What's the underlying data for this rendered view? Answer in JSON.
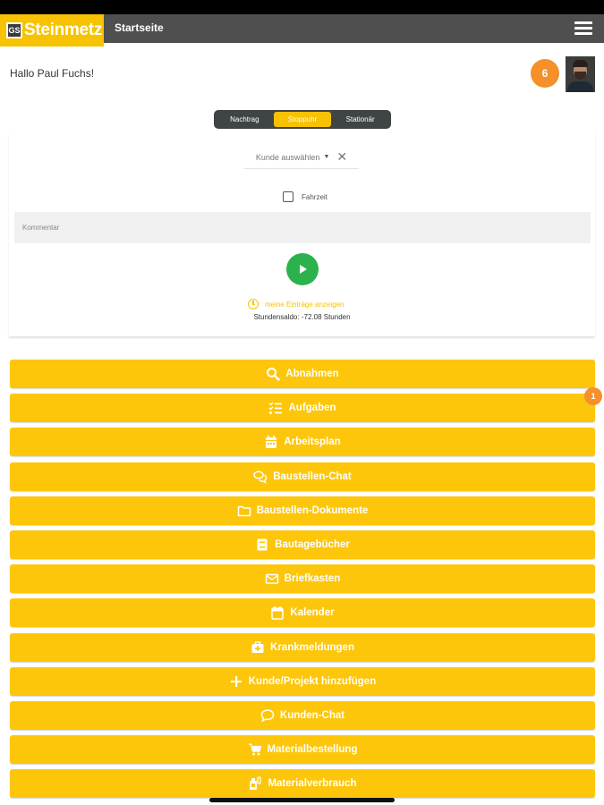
{
  "header": {
    "logo_text": "Steinmetz",
    "logo_mark": "GS",
    "title": "Startseite",
    "menu_icon": "hamburger-icon"
  },
  "user": {
    "greeting": "Hallo Paul Fuchs!",
    "notification_count": "6"
  },
  "tracking": {
    "modes": [
      "Nachtrag",
      "Stoppuhr",
      "Stationär"
    ],
    "active_mode": "Stoppuhr",
    "customer_placeholder": "Kunde auswählen",
    "travel_label": "Fahrzeit",
    "travel_checked": false,
    "comment_placeholder": "Kommentar",
    "entries_link": "meine Einträge anzeigen",
    "balance": "Stundensaldo: -72.08 Stunden"
  },
  "nav": {
    "items": [
      {
        "label": "Abnahmen",
        "icon": "search-icon"
      },
      {
        "label": "Aufgaben",
        "icon": "task-list-icon"
      },
      {
        "label": "Arbeitsplan",
        "icon": "calendar-icon"
      },
      {
        "label": "Baustellen-Chat",
        "icon": "chat-bubbles-icon"
      },
      {
        "label": "Baustellen-Dokumente",
        "icon": "folder-icon"
      },
      {
        "label": "Bautagebücher",
        "icon": "book-icon"
      },
      {
        "label": "Briefkasten",
        "icon": "envelope-icon"
      },
      {
        "label": "Kalender",
        "icon": "calendar-icon"
      },
      {
        "label": "Krankmeldungen",
        "icon": "medical-kit-icon"
      },
      {
        "label": "Kunde/Projekt hinzufügen",
        "icon": "plus-icon"
      },
      {
        "label": "Kunden-Chat",
        "icon": "chat-bubble-icon"
      },
      {
        "label": "Materialbestellung",
        "icon": "cart-icon"
      },
      {
        "label": "Materialverbrauch",
        "icon": "material-icon"
      }
    ],
    "aufgaben_badge": "1"
  },
  "colors": {
    "accent": "#fdc60a",
    "header_bg": "#4f4f4f",
    "badge": "#f5902a",
    "play": "#2bb24c"
  }
}
